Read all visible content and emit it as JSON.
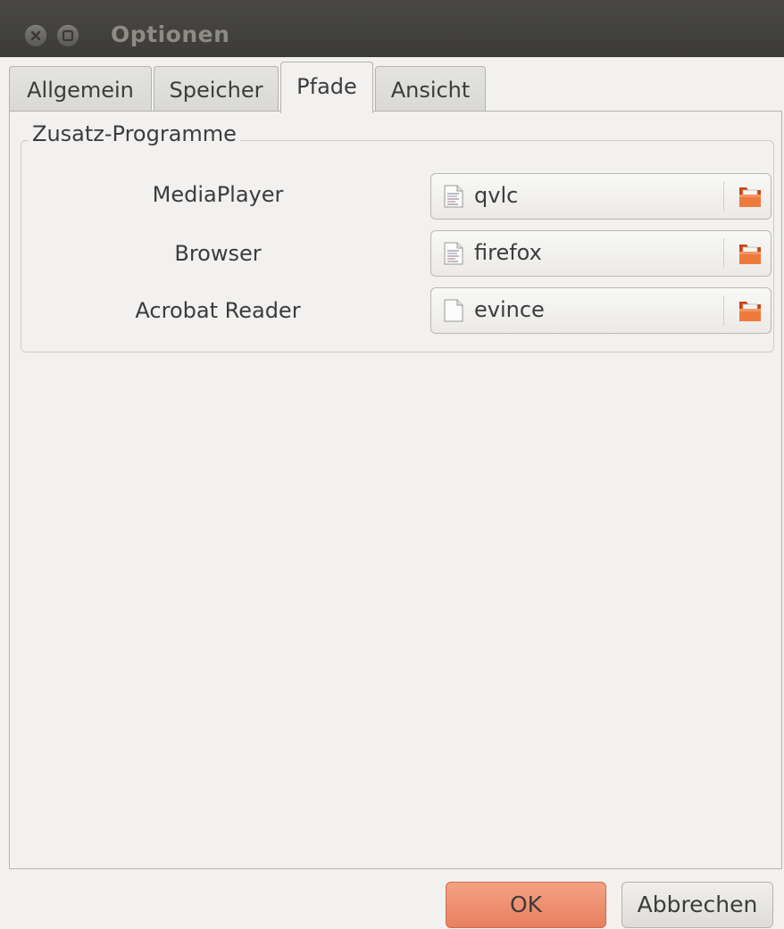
{
  "window": {
    "title": "Optionen"
  },
  "tabs": [
    {
      "label": "Allgemein",
      "active": false
    },
    {
      "label": "Speicher",
      "active": false
    },
    {
      "label": "Pfade",
      "active": true
    },
    {
      "label": "Ansicht",
      "active": false
    }
  ],
  "group": {
    "title": "Zusatz-Programme",
    "rows": [
      {
        "label": "MediaPlayer",
        "value": "qvlc",
        "icon": "text-file-icon"
      },
      {
        "label": "Browser",
        "value": "firefox",
        "icon": "text-file-icon"
      },
      {
        "label": "Acrobat Reader",
        "value": "evince",
        "icon": "blank-file-icon"
      }
    ]
  },
  "buttons": {
    "ok_label": "OK",
    "cancel_label": "Abbrechen"
  },
  "colors": {
    "titlebar": "#3c3b37",
    "accent_ok": "#e8805f",
    "background": "#f2f1f0",
    "folder_icon": "#e05a20"
  }
}
